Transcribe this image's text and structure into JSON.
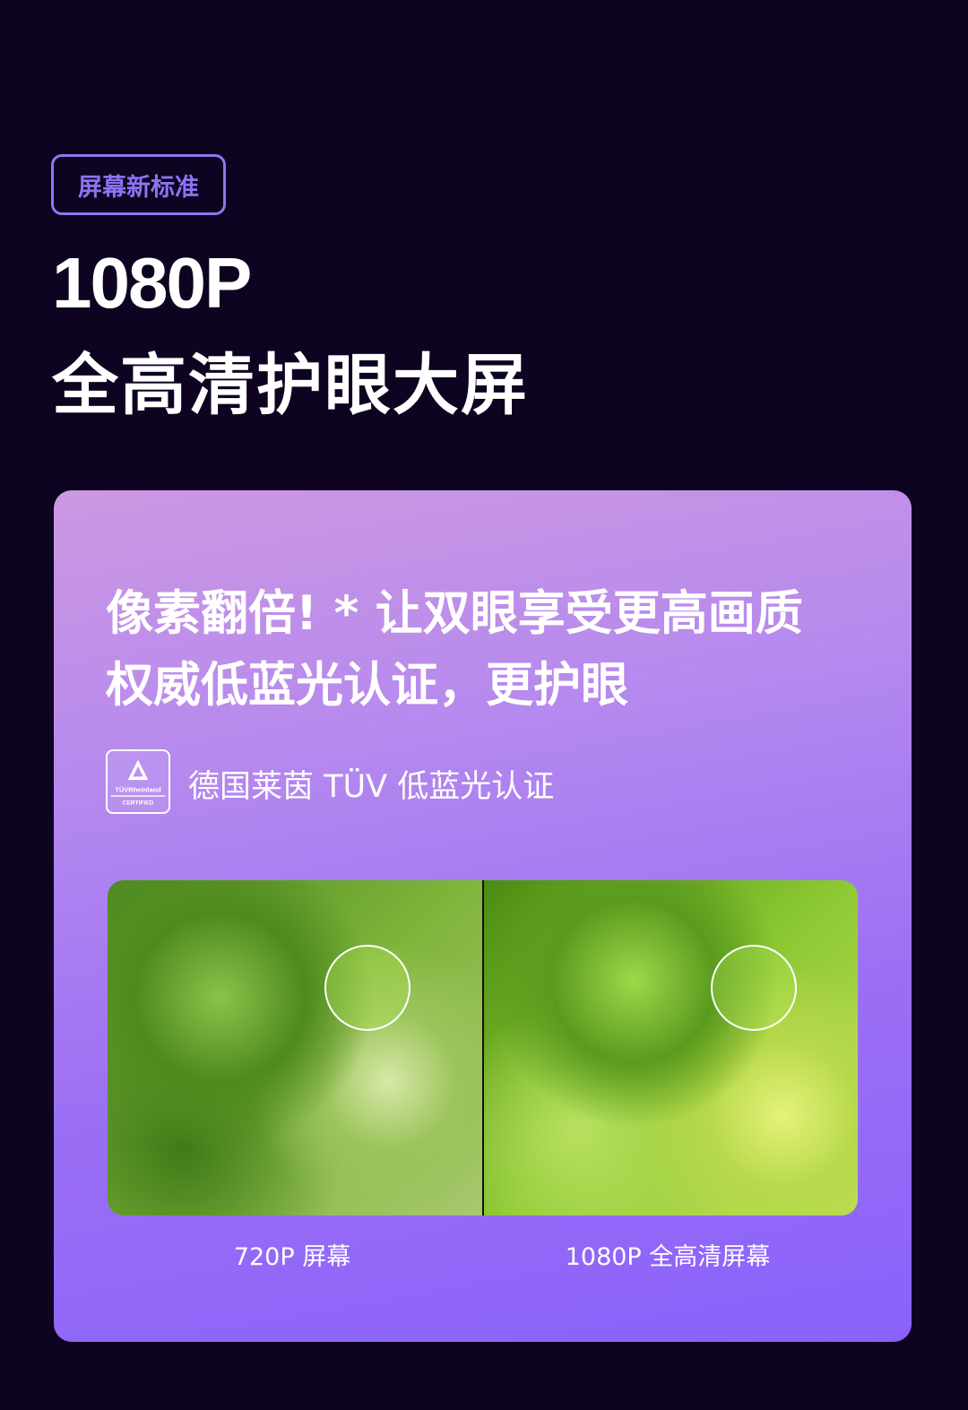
{
  "badge": "屏幕新标准",
  "title_line1": "1080P",
  "title_line2": "全高清护眼大屏",
  "card": {
    "headline1": "像素翻倍! * 让双眼享受更高画质",
    "headline2": "权威低蓝光认证，更护眼",
    "logo_text": [
      "TÜVRheinland",
      "CERTIFIED"
    ],
    "cert_text": "德国莱茵 TÜV 低蓝光认证",
    "label_left": "720P 屏幕",
    "label_right": "1080P 全高清屏幕"
  }
}
